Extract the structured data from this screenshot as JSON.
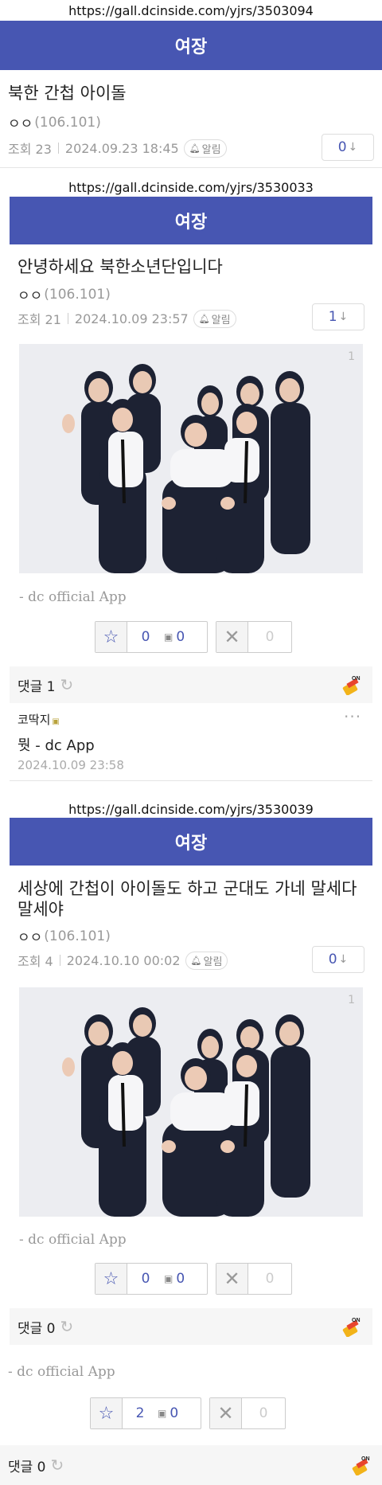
{
  "post1": {
    "url": "https://gall.dcinside.com/yjrs/3503094",
    "gallery": "여장",
    "title": "북한 간첩 아이돌",
    "writer": "ㅇㅇ",
    "ip": "(106.101)",
    "views": "조회 23",
    "date": "2024.09.23 18:45",
    "alarm": "알림",
    "comment_count": "0"
  },
  "post2": {
    "url": "https://gall.dcinside.com/yjrs/3530033",
    "gallery": "여장",
    "title": "안녕하세요 북한소년단입니다",
    "writer": "ㅇㅇ",
    "ip": "(106.101)",
    "views": "조회 21",
    "date": "2024.10.09 23:57",
    "alarm": "알림",
    "comment_count": "1",
    "image_index": "1",
    "app_sig": "- dc official App",
    "recommend": "0",
    "fixed_recommend": "0",
    "downvote": "0",
    "comments_label": "댓글 1",
    "comment": {
      "author": "코딱지",
      "text": "뭣 - dc App",
      "date": "2024.10.09 23:58"
    }
  },
  "post3": {
    "url": "https://gall.dcinside.com/yjrs/3530039",
    "gallery": "여장",
    "title": "세상에 간첩이 아이돌도 하고 군대도 가네 말세다 말세야",
    "writer": "ㅇㅇ",
    "ip": "(106.101)",
    "views": "조회 4",
    "date": "2024.10.10 00:02",
    "alarm": "알림",
    "comment_count": "0",
    "image_index": "1",
    "app_sig": "- dc official App",
    "recommend": "0",
    "fixed_recommend": "0",
    "downvote": "0",
    "comments_label": "댓글 0"
  },
  "post1_footer": {
    "app_sig": "- dc official App",
    "recommend": "2",
    "fixed_recommend": "0",
    "downvote": "0",
    "comments_label": "댓글 0"
  },
  "icons": {
    "star": "star-icon",
    "downvote": "x-icon",
    "bell": "bell-icon",
    "refresh": "refresh-icon",
    "on_badge": "on-broom-icon"
  },
  "colors": {
    "brand": "#4756b2"
  }
}
